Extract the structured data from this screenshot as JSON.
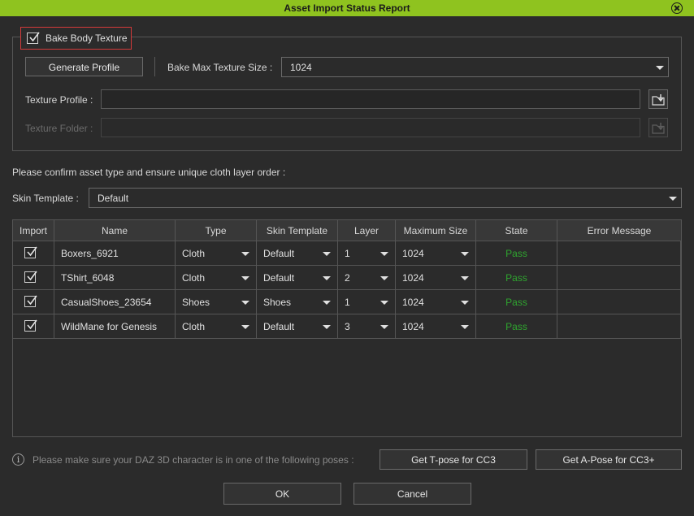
{
  "window": {
    "title": "Asset Import Status Report"
  },
  "bake": {
    "label": "Bake Body Texture",
    "checked": true
  },
  "toolbar": {
    "generate_label": "Generate Profile",
    "max_size_label": "Bake Max Texture Size :",
    "max_size_value": "1024"
  },
  "texture_profile": {
    "label": "Texture Profile :",
    "value": ""
  },
  "texture_folder": {
    "label": "Texture Folder :",
    "value": ""
  },
  "instruction": "Please confirm asset type and ensure unique cloth layer order :",
  "skin_template": {
    "label": "Skin Template :",
    "value": "Default"
  },
  "table": {
    "headers": [
      "Import",
      "Name",
      "Type",
      "Skin Template",
      "Layer",
      "Maximum Size",
      "State",
      "Error Message"
    ],
    "rows": [
      {
        "import": true,
        "name": "Boxers_6921",
        "type": "Cloth",
        "skin": "Default",
        "layer": "1",
        "max": "1024",
        "state": "Pass",
        "error": ""
      },
      {
        "import": true,
        "name": "TShirt_6048",
        "type": "Cloth",
        "skin": "Default",
        "layer": "2",
        "max": "1024",
        "state": "Pass",
        "error": ""
      },
      {
        "import": true,
        "name": "CasualShoes_23654",
        "type": "Shoes",
        "skin": "Shoes",
        "layer": "1",
        "max": "1024",
        "state": "Pass",
        "error": ""
      },
      {
        "import": true,
        "name": "WildMane for Genesis",
        "type": "Cloth",
        "skin": "Default",
        "layer": "3",
        "max": "1024",
        "state": "Pass",
        "error": ""
      }
    ]
  },
  "footer": {
    "info_text": "Please make sure your DAZ 3D character is in one of the following poses :",
    "tpose_label": "Get T-pose for CC3",
    "apose_label": "Get A-Pose for CC3+",
    "ok_label": "OK",
    "cancel_label": "Cancel"
  },
  "colors": {
    "titlebar": "#8fc31f",
    "pass": "#2fa62f",
    "highlight": "#d43a3a",
    "background": "#2b2b2b"
  },
  "icons": {
    "close": "close-circle-icon",
    "browse": "folder-import-icon",
    "info": "info-icon"
  }
}
